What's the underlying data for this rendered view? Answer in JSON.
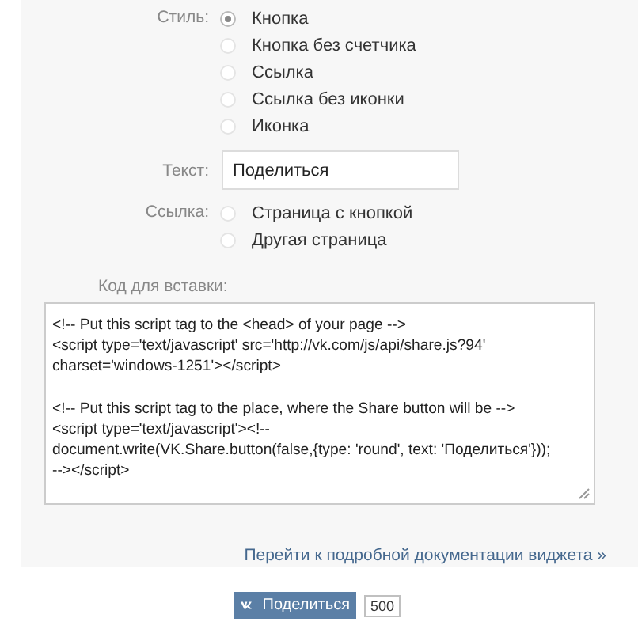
{
  "style": {
    "label": "Стиль:",
    "options": [
      {
        "label": "Кнопка",
        "selected": true
      },
      {
        "label": "Кнопка без счетчика",
        "selected": false
      },
      {
        "label": "Ссылка",
        "selected": false
      },
      {
        "label": "Ссылка без иконки",
        "selected": false
      },
      {
        "label": "Иконка",
        "selected": false
      }
    ]
  },
  "text": {
    "label": "Текст:",
    "value": "Поделиться"
  },
  "link": {
    "label": "Ссылка:",
    "options": [
      {
        "label": "Страница с кнопкой",
        "selected": false
      },
      {
        "label": "Другая страница",
        "selected": false
      }
    ]
  },
  "code": {
    "label": "Код для вставки:",
    "blocks": [
      [
        "<!-- Put this script tag to the <head> of your page -->",
        "<script type='text/javascript' src='http://vk.com/js/api/share.js?94'",
        "charset='windows-1251'></script>"
      ],
      [
        "<!-- Put this script tag to the place, where the Share button will be -->",
        "<script type='text/javascript'><!--",
        "document.write(VK.Share.button(false,{type: 'round', text: 'Поделиться'}));",
        "--></script>"
      ]
    ]
  },
  "docs_link": "Перейти к подробной документации виджета »",
  "share": {
    "label": "Поделиться",
    "count": "500"
  }
}
